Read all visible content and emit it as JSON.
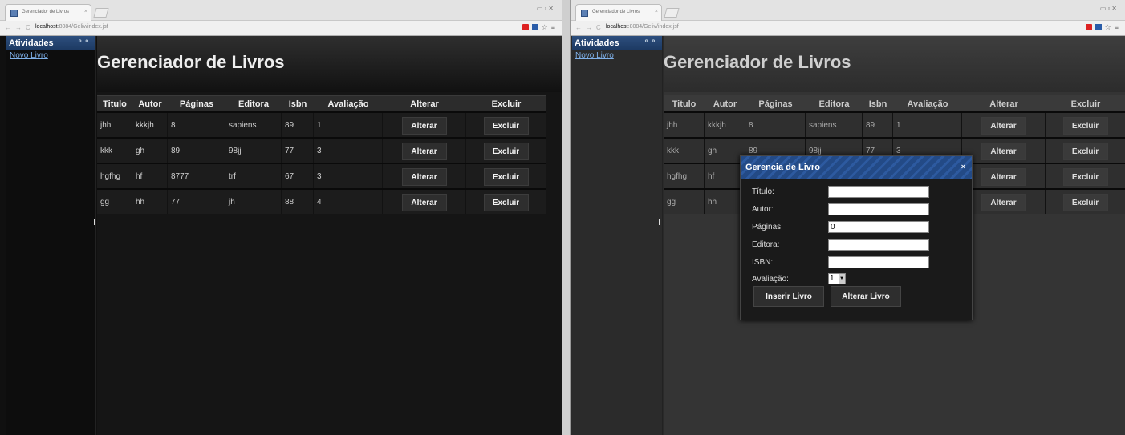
{
  "browser": {
    "tab_title": "Gerenciador de Livros",
    "url_host": "localhost",
    "url_path": ":8084/Geliv/index.jsf"
  },
  "sidebar": {
    "title": "Atividades",
    "link": "Novo Livro"
  },
  "page": {
    "title": "Gerenciador de Livros"
  },
  "table": {
    "headers": [
      "Titulo",
      "Autor",
      "Páginas",
      "Editora",
      "Isbn",
      "Avaliação",
      "Alterar",
      "Excluir"
    ],
    "rows": [
      {
        "titulo": "jhh",
        "autor": "kkkjh",
        "paginas": "8",
        "editora": "sapiens",
        "isbn": "89",
        "avaliacao": "1",
        "alterar": "Alterar",
        "excluir": "Excluir"
      },
      {
        "titulo": "kkk",
        "autor": "gh",
        "paginas": "89",
        "editora": "98jj",
        "isbn": "77",
        "avaliacao": "3",
        "alterar": "Alterar",
        "excluir": "Excluir"
      },
      {
        "titulo": "hgfhg",
        "autor": "hf",
        "paginas": "8777",
        "editora": "trf",
        "isbn": "67",
        "avaliacao": "3",
        "alterar": "Alterar",
        "excluir": "Excluir"
      },
      {
        "titulo": "gg",
        "autor": "hh",
        "paginas": "77",
        "editora": "jh",
        "isbn": "88",
        "avaliacao": "4",
        "alterar": "Alterar",
        "excluir": "Excluir"
      }
    ]
  },
  "dialog": {
    "title": "Gerencia de Livro",
    "close": "×",
    "labels": {
      "titulo": "Título:",
      "autor": "Autor:",
      "paginas": "Páginas:",
      "editora": "Editora:",
      "isbn": "ISBN:",
      "avaliacao": "Avaliação:"
    },
    "values": {
      "titulo": "",
      "autor": "",
      "paginas": "0",
      "editora": "",
      "isbn": "",
      "avaliacao": "1"
    },
    "insert_button": "Inserir Livro",
    "update_button": "Alterar Livro"
  },
  "colors": {
    "header_blue": "#234a86",
    "link_blue": "#7fb0e8",
    "background": "#151515"
  }
}
